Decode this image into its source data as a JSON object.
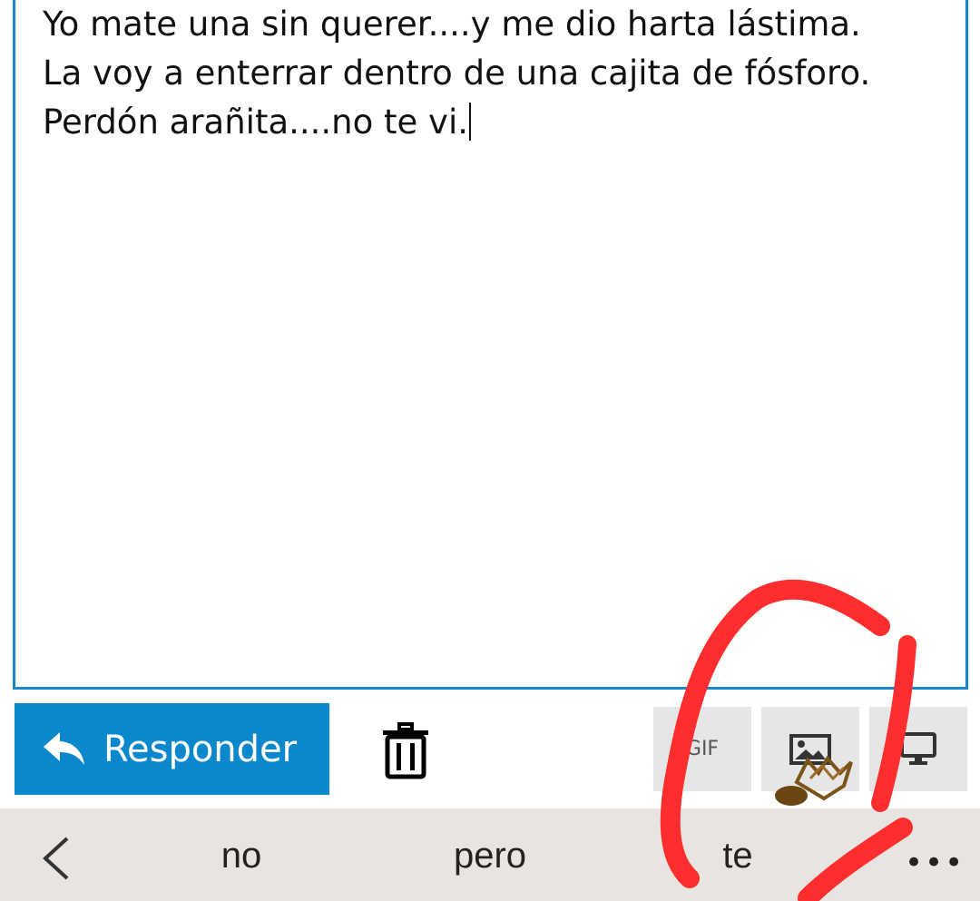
{
  "composer": {
    "text": "Yo mate una sin querer....y me dio harta lástima.\nLa voy a enterrar dentro de una cajita de fósforo.\nPerdón arañita....no te vi."
  },
  "actions": {
    "reply_label": "Responder",
    "gif_label": "GIF"
  },
  "keyboard": {
    "suggestions": [
      "no",
      "pero",
      "te"
    ]
  },
  "colors": {
    "accent": "#0b87cc",
    "border": "#1a87c9",
    "annotation": "#ff2e2e",
    "suggest_bar": "#e8e4e1"
  }
}
